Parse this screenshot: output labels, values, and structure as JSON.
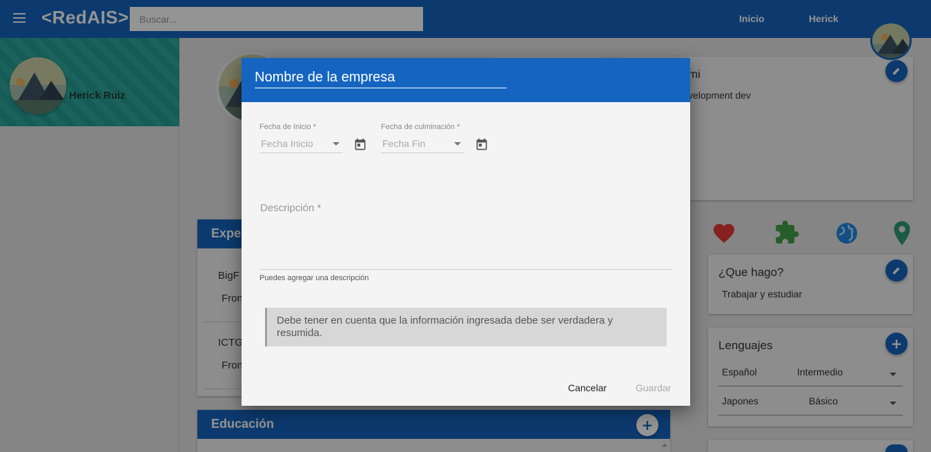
{
  "header": {
    "logo": "<RedAIS>",
    "search_placeholder": "Buscar...",
    "nav": [
      "Inicio",
      "Herick"
    ]
  },
  "sidebar": {
    "profile_name": "Herick Ruiz"
  },
  "background": {
    "about_fragment_title": "mi",
    "about_fragment_text": "velopment dev",
    "experience": {
      "title_fragment": "Expe",
      "items": [
        {
          "company_fragment": "BigF",
          "role_fragment": "Fron"
        },
        {
          "company_fragment": "ICTG",
          "role_fragment": "Fron"
        }
      ]
    },
    "education": {
      "title": "Educación"
    },
    "que_hago": {
      "title": "¿Que hago?",
      "text": "Trabajar y estudiar"
    },
    "languages": {
      "title": "Lenguajes",
      "rows": [
        {
          "language": "Español",
          "level": "Intermedio"
        },
        {
          "language": "Japones",
          "level": "Básico"
        }
      ]
    },
    "icons": [
      "heart-icon",
      "puzzle-icon",
      "globe-icon",
      "location-pin-icon"
    ]
  },
  "modal": {
    "company_placeholder": "Nombre de la empresa",
    "start": {
      "label": "Fecha de Inicio *",
      "placeholder": "Fecha Inicio"
    },
    "end": {
      "label": "Fecha de culminación *",
      "placeholder": "Fecha Fin"
    },
    "description": {
      "label": "Descripción *",
      "hint": "Puedes agregar una descripción"
    },
    "notice": "Debe tener en cuenta que la información ingresada debe ser verdadera y resumida.",
    "cancel_label": "Cancelar",
    "save_label": "Guardar"
  },
  "colors": {
    "primary": "#1565c0",
    "teal": "#26a69a",
    "heart": "#e53935",
    "puzzle": "#43a047",
    "globe": "#1e88e5",
    "pin": "#2e9b78"
  }
}
